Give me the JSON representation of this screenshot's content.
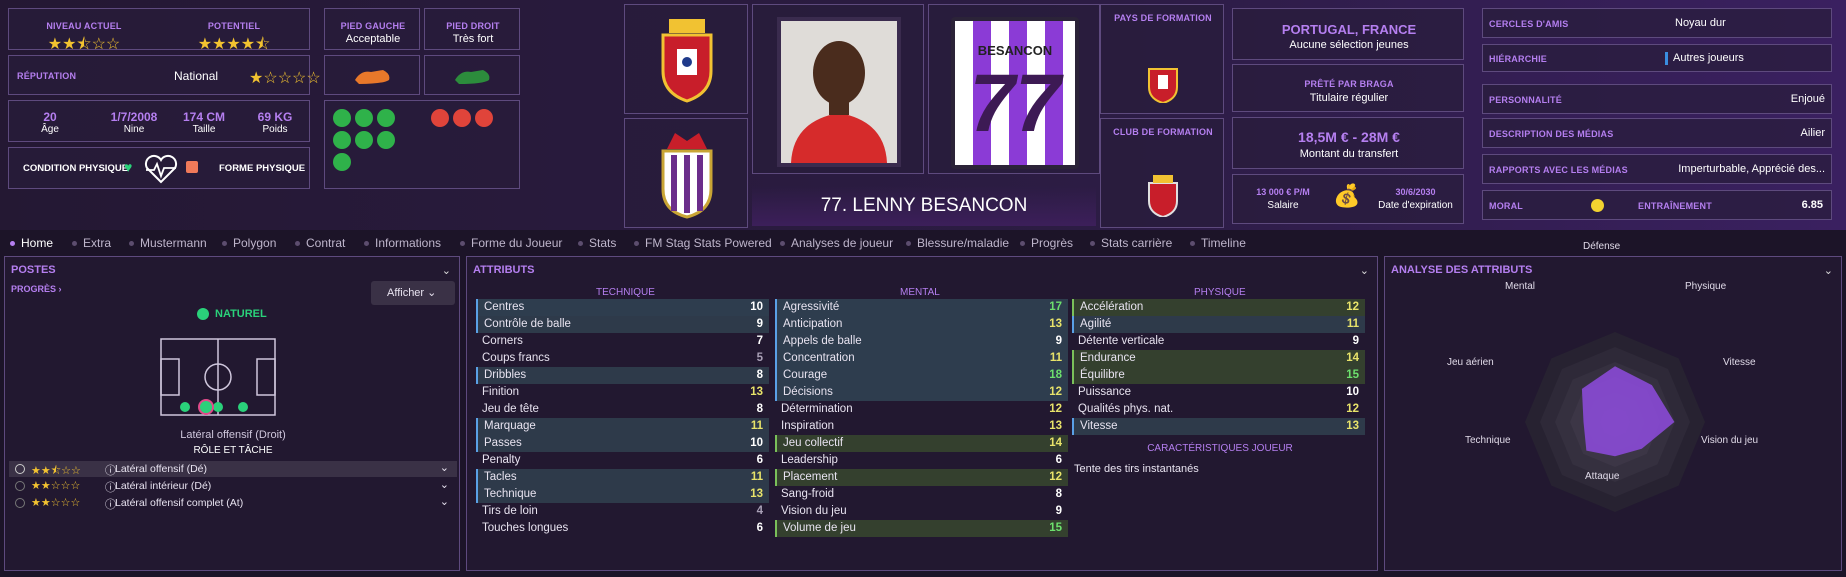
{
  "overview": {
    "current_level_label": "NIVEAU ACTUEL",
    "current_level_stars": "★★⯪☆☆",
    "potential_label": "POTENTIEL",
    "potential_stars": "★★★★⯪",
    "reputation_label": "RÉPUTATION",
    "reputation_value": "National",
    "reputation_stars": "★☆☆☆☆",
    "age_value": "20",
    "age_label": "Âge",
    "dob_value": "1/7/2008",
    "dob_label": "Nine",
    "height_value": "174 CM",
    "height_label": "Taille",
    "weight_value": "69 KG",
    "weight_label": "Poids",
    "condition_label": "CONDITION PHYSIQUE",
    "form_label": "FORME PHYSIQUE"
  },
  "feet": {
    "left_label": "PIED GAUCHE",
    "left_value": "Acceptable",
    "right_label": "PIED DROIT",
    "right_value": "Très fort"
  },
  "player": {
    "name": "77. LENNY BESANCON",
    "shirt_name": "BESANCON",
    "shirt_number": "77"
  },
  "training": {
    "country_label": "PAYS DE FORMATION",
    "club_label": "CLUB DE FORMATION"
  },
  "nation": {
    "title": "PORTUGAL, FRANCE",
    "subtitle": "Aucune sélection jeunes"
  },
  "loan": {
    "title": "PRÊTÉ PAR BRAGA",
    "subtitle": "Titulaire régulier"
  },
  "transfer": {
    "value": "18,5M € - 28M €",
    "label": "Montant du transfert"
  },
  "contract": {
    "salary_value": "13 000 € P/M",
    "salary_label": "Salaire",
    "expiry_value": "30/6/2030",
    "expiry_label": "Date d'expiration"
  },
  "personal": [
    {
      "label": "CERCLES D'AMIS",
      "value": "Noyau dur"
    },
    {
      "label": "HIÉRARCHIE",
      "value": "Autres joueurs"
    },
    {
      "label": "PERSONNALITÉ",
      "value": "Enjoué"
    },
    {
      "label": "DESCRIPTION DES MÉDIAS",
      "value": "Ailier"
    },
    {
      "label": "RAPPORTS AVEC LES MÉDIAS",
      "value": "Imperturbable, Apprécié des..."
    }
  ],
  "morale": {
    "label": "MORAL",
    "training_label": "ENTRAÎNEMENT",
    "training_value": "6.85"
  },
  "tabs": [
    "Home",
    "Extra",
    "Mustermann",
    "Polygon",
    "Contrat",
    "Informations",
    "Forme du Joueur",
    "Stats",
    "FM Stag Stats Powered",
    "Analyses de joueur",
    "Blessure/maladie",
    "Progrès",
    "Stats carrière",
    "Timeline"
  ],
  "positions": {
    "title": "POSTES",
    "progress": "PROGRÈS ›",
    "show_button": "Afficher",
    "natural": "NATUREL",
    "position_name": "Latéral offensif (Droit)",
    "role_title": "RÔLE ET TÂCHE",
    "roles": [
      {
        "name": "Latéral offensif (Dé)",
        "stars": "★★⯪☆☆"
      },
      {
        "name": "Latéral intérieur (Dé)",
        "stars": "★★☆☆☆"
      },
      {
        "name": "Latéral offensif complet (At)",
        "stars": "★★☆☆☆"
      }
    ]
  },
  "attributes": {
    "title": "ATTRIBUTS",
    "technical_header": "TECHNIQUE",
    "mental_header": "MENTAL",
    "physical_header": "PHYSIQUE",
    "technical": [
      [
        "Centres",
        "10"
      ],
      [
        "Contrôle de balle",
        "9"
      ],
      [
        "Corners",
        "7"
      ],
      [
        "Coups francs",
        "5"
      ],
      [
        "Dribbles",
        "8"
      ],
      [
        "Finition",
        "13"
      ],
      [
        "Jeu de tête",
        "8"
      ],
      [
        "Marquage",
        "11"
      ],
      [
        "Passes",
        "10"
      ],
      [
        "Penalty",
        "6"
      ],
      [
        "Tacles",
        "11"
      ],
      [
        "Technique",
        "13"
      ],
      [
        "Tirs de loin",
        "4"
      ],
      [
        "Touches longues",
        "6"
      ]
    ],
    "mental": [
      [
        "Agressivité",
        "17"
      ],
      [
        "Anticipation",
        "13"
      ],
      [
        "Appels de balle",
        "9"
      ],
      [
        "Concentration",
        "11"
      ],
      [
        "Courage",
        "18"
      ],
      [
        "Décisions",
        "12"
      ],
      [
        "Détermination",
        "12"
      ],
      [
        "Inspiration",
        "13"
      ],
      [
        "Jeu collectif",
        "14"
      ],
      [
        "Leadership",
        "6"
      ],
      [
        "Placement",
        "12"
      ],
      [
        "Sang-froid",
        "8"
      ],
      [
        "Vision du jeu",
        "9"
      ],
      [
        "Volume de jeu",
        "15"
      ]
    ],
    "physical": [
      [
        "Accélération",
        "12"
      ],
      [
        "Agilité",
        "11"
      ],
      [
        "Détente verticale",
        "9"
      ],
      [
        "Endurance",
        "14"
      ],
      [
        "Équilibre",
        "15"
      ],
      [
        "Puissance",
        "10"
      ],
      [
        "Qualités phys. nat.",
        "12"
      ],
      [
        "Vitesse",
        "13"
      ]
    ],
    "traits_header": "CARACTÉRISTIQUES JOUEUR",
    "trait": "Tente des tirs instantanés"
  },
  "analysis": {
    "title": "ANALYSE DES ATTRIBUTS",
    "labels": [
      "Défense",
      "Physique",
      "Vitesse",
      "Vision du jeu",
      "Attaque",
      "Technique",
      "Jeu aérien",
      "Mental"
    ]
  }
}
